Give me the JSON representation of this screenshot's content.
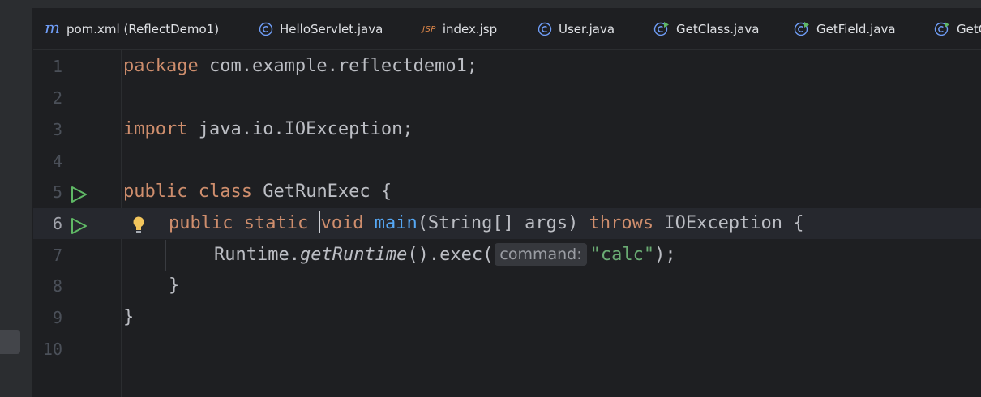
{
  "tabs": [
    {
      "label": "pom.xml (ReflectDemo1)",
      "icon": "maven-icon"
    },
    {
      "label": "HelloServlet.java",
      "icon": "class-icon"
    },
    {
      "label": "index.jsp",
      "icon": "jsp-icon"
    },
    {
      "label": "User.java",
      "icon": "class-icon"
    },
    {
      "label": "GetClass.java",
      "icon": "runnable-class-icon"
    },
    {
      "label": "GetField.java",
      "icon": "runnable-class-icon"
    },
    {
      "label": "GetC",
      "icon": "runnable-class-icon"
    }
  ],
  "icons": {
    "maven_glyph": "m",
    "jsp_glyph": "JSP"
  },
  "editor": {
    "line_numbers": [
      "1",
      "2",
      "3",
      "4",
      "5",
      "6",
      "7",
      "8",
      "9",
      "10"
    ],
    "code": {
      "l1_kw": "package",
      "l1_rest": " com.example.reflectdemo1;",
      "l3_kw": "import",
      "l3_rest": " java.io.IOException;",
      "l5_kw1": "public",
      "l5_kw2": "class",
      "l5_rest": " GetRunExec {",
      "l6_kw1": "public",
      "l6_kw2": "static",
      "l6_kw3": "void",
      "l6_fn": "main",
      "l6_mid": "(String[] args) ",
      "l6_kw4": "throws",
      "l6_rest": " IOException {",
      "l7_a": "Runtime.",
      "l7_b": "getRuntime",
      "l7_c": "().exec(",
      "l7_hint": "command:",
      "l7_str": "\"calc\"",
      "l7_end": ");",
      "l8": "}",
      "l9": "}"
    }
  },
  "colors": {
    "background": "#1e1f22",
    "keyword": "#cf8e6d",
    "function": "#56a8f5",
    "string": "#6aab73",
    "text": "#bcbec4",
    "run_icon": "#5fb865"
  }
}
